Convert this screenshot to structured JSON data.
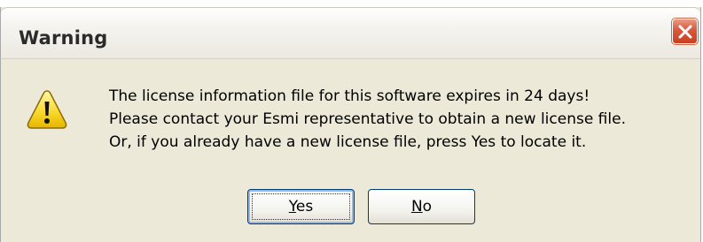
{
  "dialog": {
    "title": "Warning",
    "close_icon": "close-icon",
    "warning_icon": "warning-icon",
    "message_lines": [
      "The license information file for this software expires in 24 days!",
      "Please contact your Esmi representative to obtain a new license file.",
      "Or, if you already have a new license file, press Yes to locate it."
    ],
    "buttons": {
      "yes_mnemonic": "Y",
      "yes_rest": "es",
      "no_mnemonic": "N",
      "no_rest": "o"
    }
  }
}
